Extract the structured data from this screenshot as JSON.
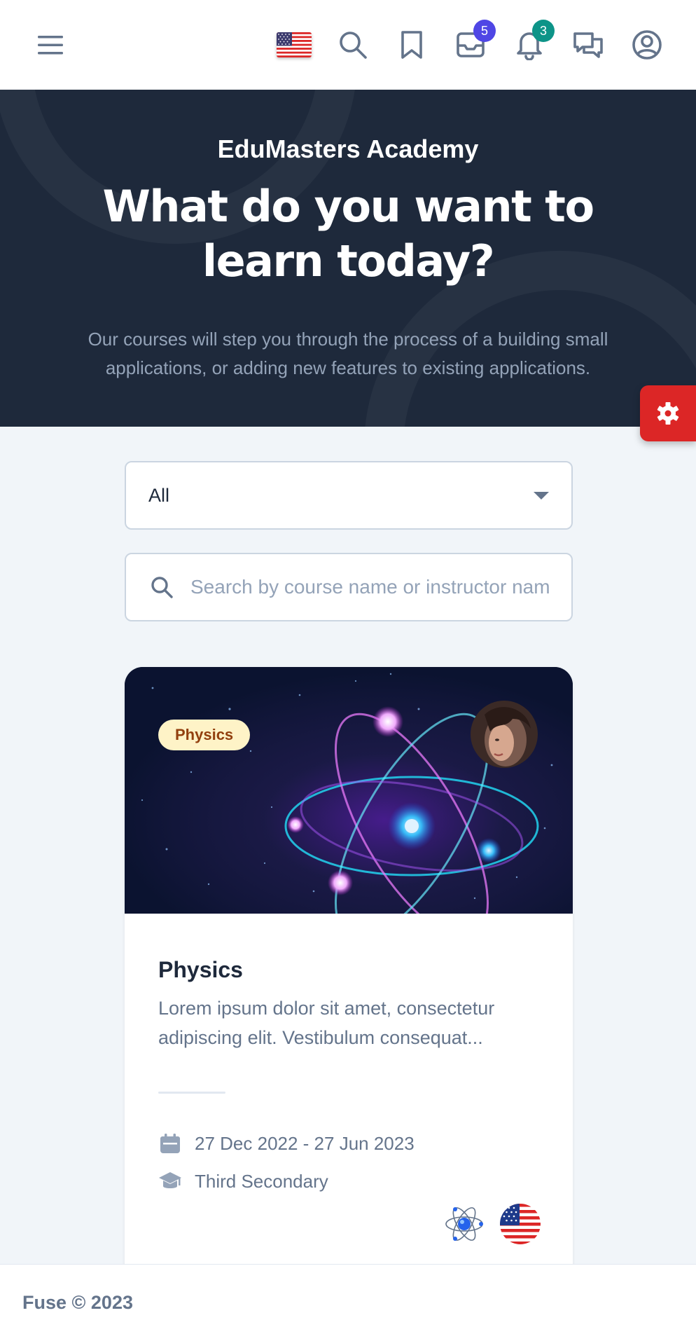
{
  "header": {
    "icons": [
      "menu-icon",
      "us-flag-icon",
      "search-icon",
      "bookmark-icon",
      "mail-icon",
      "bell-icon",
      "chat-icon",
      "user-circle-icon"
    ],
    "mail_badge": "5",
    "notifications_badge": "3",
    "colors": {
      "mail_badge": "#4f46e5",
      "notifications_badge": "#0d9488"
    }
  },
  "hero": {
    "subtitle": "EduMasters Academy",
    "title": "What do you want to learn today?",
    "description": "Our courses will step you through the process of a building small applications, or adding new features to existing applications."
  },
  "settings": {
    "icon": "gear-icon",
    "color": "#dc2626"
  },
  "filters": {
    "category_selected": "All",
    "search_placeholder": "Search by course name or instructor name",
    "search_value": ""
  },
  "course": {
    "category": "Physics",
    "title": "Physics",
    "description": "Lorem ipsum dolor sit amet, consectetur adipiscing elit. Vestibulum consequat...",
    "dates": "27 Dec 2022 - 27 Jun 2023",
    "level": "Third Secondary",
    "icons": [
      "calendar-icon",
      "graduation-cap-icon",
      "atom-icon",
      "us-flag-icon"
    ]
  },
  "footer": {
    "text": "Fuse © 2023"
  }
}
